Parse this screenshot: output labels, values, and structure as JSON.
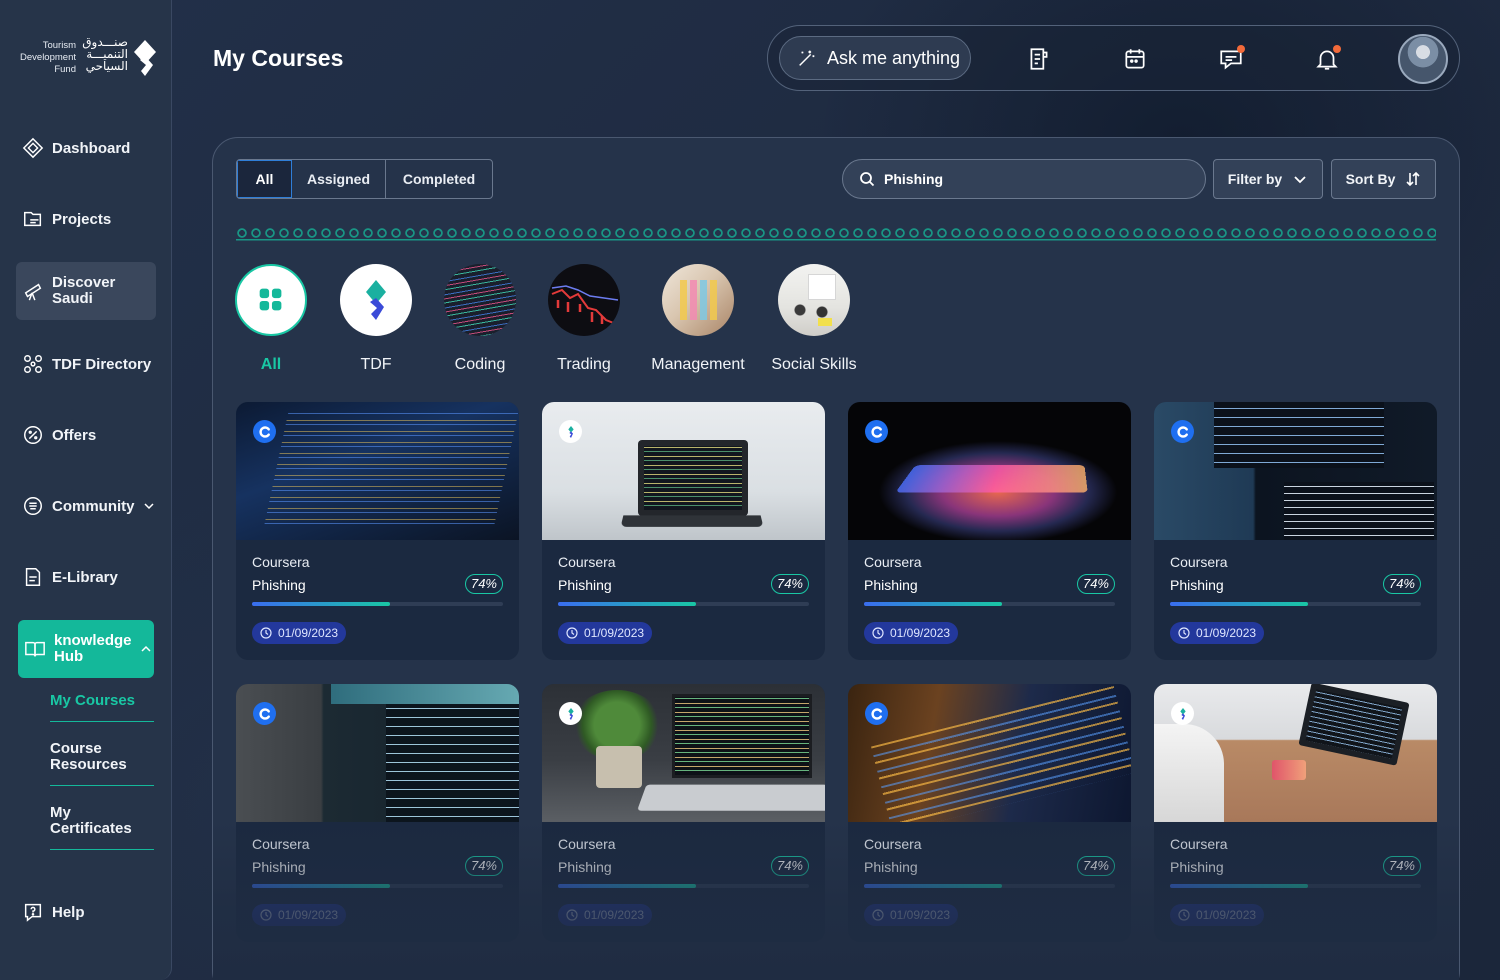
{
  "brand": {
    "name_en": [
      "Tourism",
      "Development",
      "Fund"
    ],
    "name_ar": [
      "صنـــدوق",
      "التنميـــة",
      "السياحي"
    ],
    "colors": {
      "accent": "#14b89a",
      "accent_text": "#19c7a4",
      "primary_blue": "#23389c",
      "notification": "#f26a3a"
    }
  },
  "sidebar": {
    "items": [
      {
        "label": "Dashboard",
        "icon": "diamond-grid-icon"
      },
      {
        "label": "Projects",
        "icon": "folder-list-icon"
      },
      {
        "label": "Discover Saudi",
        "icon": "telescope-icon"
      },
      {
        "label": "TDF Directory",
        "icon": "network-icon"
      },
      {
        "label": "Offers",
        "icon": "percent-badge-icon"
      },
      {
        "label": "Community",
        "icon": "community-icon"
      },
      {
        "label": "E-Library",
        "icon": "document-icon"
      },
      {
        "label": "knowledge Hub",
        "icon": "open-book-icon"
      }
    ],
    "sub_items": [
      "My Courses",
      "Course Resources",
      "My Certificates"
    ],
    "help_label": "Help"
  },
  "header": {
    "title": "My Courses",
    "ask_label": "Ask me anything"
  },
  "toolbar": {
    "tabs": [
      "All",
      "Assigned",
      "Completed"
    ],
    "search_value": "Phishing",
    "filter_label": "Filter by",
    "sort_label": "Sort By"
  },
  "categories": [
    "All",
    "TDF",
    "Coding",
    "Trading",
    "Management",
    "Social Skills"
  ],
  "courses": [
    {
      "provider": "Coursera",
      "name": "Phishing",
      "percent_label": "74%",
      "progress": 0.55,
      "date": "01/09/2023",
      "badge": "coursera-icon"
    },
    {
      "provider": "Coursera",
      "name": "Phishing",
      "percent_label": "74%",
      "progress": 0.55,
      "date": "01/09/2023",
      "badge": "tdf-logo-icon"
    },
    {
      "provider": "Coursera",
      "name": "Phishing",
      "percent_label": "74%",
      "progress": 0.55,
      "date": "01/09/2023",
      "badge": "coursera-icon"
    },
    {
      "provider": "Coursera",
      "name": "Phishing",
      "percent_label": "74%",
      "progress": 0.55,
      "date": "01/09/2023",
      "badge": "coursera-icon"
    },
    {
      "provider": "Coursera",
      "name": "Phishing",
      "percent_label": "74%",
      "progress": 0.55,
      "date": "01/09/2023",
      "badge": "coursera-icon"
    },
    {
      "provider": "Coursera",
      "name": "Phishing",
      "percent_label": "74%",
      "progress": 0.55,
      "date": "01/09/2023",
      "badge": "tdf-logo-icon"
    },
    {
      "provider": "Coursera",
      "name": "Phishing",
      "percent_label": "74%",
      "progress": 0.55,
      "date": "01/09/2023",
      "badge": "coursera-icon"
    },
    {
      "provider": "Coursera",
      "name": "Phishing",
      "percent_label": "74%",
      "progress": 0.55,
      "date": "01/09/2023",
      "badge": "tdf-logo-icon"
    }
  ]
}
